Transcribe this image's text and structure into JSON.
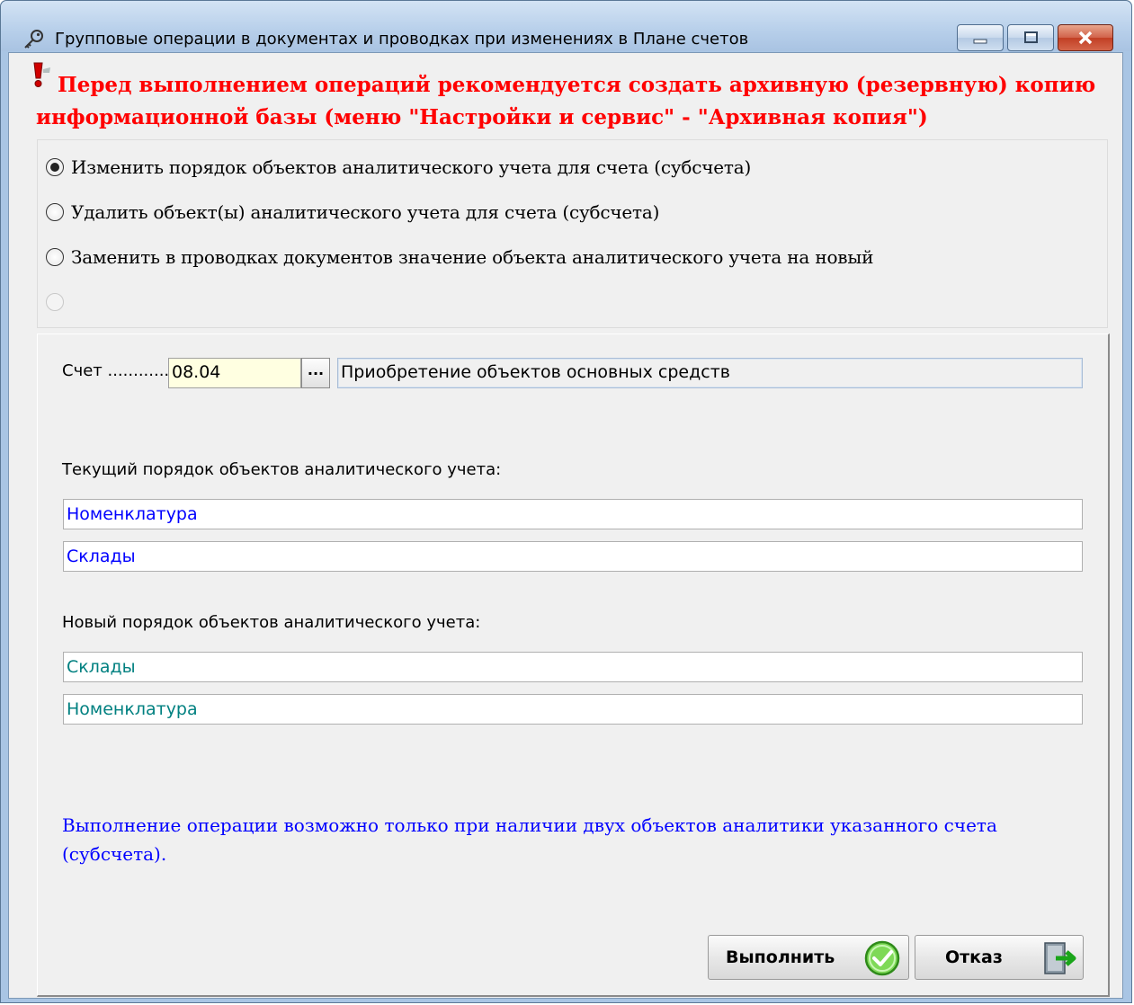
{
  "window": {
    "title": "Групповые операции в документах и проводках при изменениях в Плане счетов",
    "title_icon": "key-icon"
  },
  "warning": {
    "icon": "exclamation-icon",
    "text": "Перед выполнением операций рекомендуется создать архивную (резервную) копию информационной базы (меню \"Настройки и сервис\" - \"Архивная копия\")",
    "color": "#ff0000"
  },
  "operations": [
    {
      "label": "Изменить порядок объектов аналитического учета для счета (субсчета)",
      "checked": true,
      "enabled": true
    },
    {
      "label": "Удалить объект(ы) аналитического учета для счета (субсчета)",
      "checked": false,
      "enabled": true
    },
    {
      "label": "Заменить в проводках документов значение объекта аналитического учета на новый",
      "checked": false,
      "enabled": true
    },
    {
      "label": "",
      "checked": false,
      "enabled": false
    }
  ],
  "account": {
    "label": "Счет ............",
    "code": "08.04",
    "browse_label": "...",
    "name": "Приобретение объектов основных средств"
  },
  "current_order": {
    "label": "Текущий порядок объектов аналитического учета:",
    "items": [
      "Номенклатура",
      "Склады"
    ],
    "color": "#0000ff"
  },
  "new_order": {
    "label": "Новый порядок объектов аналитического учета:",
    "items": [
      "Склады",
      "Номенклатура"
    ],
    "color": "#008080"
  },
  "note": {
    "text": "Выполнение операции возможно только при наличии двух объектов аналитики указанного счета (субсчета).",
    "color": "#0000ff"
  },
  "buttons": {
    "run_label": "Выполнить",
    "run_icon": "check-circle-icon",
    "cancel_label": "Отказ",
    "cancel_icon": "exit-door-icon"
  }
}
